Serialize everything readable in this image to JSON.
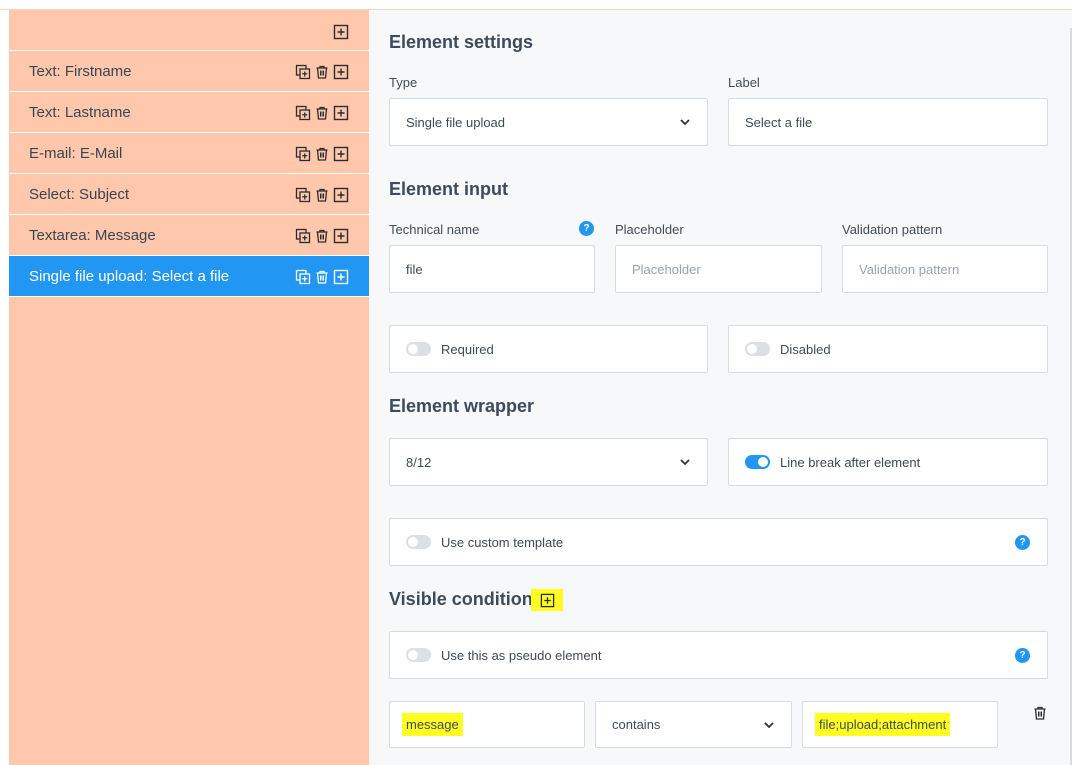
{
  "sidebar": {
    "items": [
      {
        "label": "Text: Firstname"
      },
      {
        "label": "Text: Lastname"
      },
      {
        "label": "E-mail: E-Mail"
      },
      {
        "label": "Select: Subject"
      },
      {
        "label": "Textarea: Message"
      },
      {
        "label": "Single file upload: Select a file",
        "active": true
      }
    ]
  },
  "settings": {
    "title": "Element settings",
    "type_label": "Type",
    "type_value": "Single file upload",
    "label_label": "Label",
    "label_value": "Select a file"
  },
  "input": {
    "title": "Element input",
    "technical_name_label": "Technical name",
    "technical_name_value": "file",
    "placeholder_label": "Placeholder",
    "placeholder_placeholder": "Placeholder",
    "validation_label": "Validation pattern",
    "validation_placeholder": "Validation pattern",
    "required_label": "Required",
    "disabled_label": "Disabled"
  },
  "wrapper": {
    "title": "Element wrapper",
    "width_value": "8/12",
    "line_break_label": "Line break after element",
    "custom_template_label": "Use custom template"
  },
  "conditions": {
    "title": "Visible conditions",
    "pseudo_label": "Use this as pseudo element",
    "field_value": "message",
    "operator_value": "contains",
    "match_value": "file;upload;attachment"
  },
  "colors": {
    "sidebar_bg": "#ffc8ac",
    "active_bg": "#2196f3",
    "highlight": "#ffff22"
  }
}
